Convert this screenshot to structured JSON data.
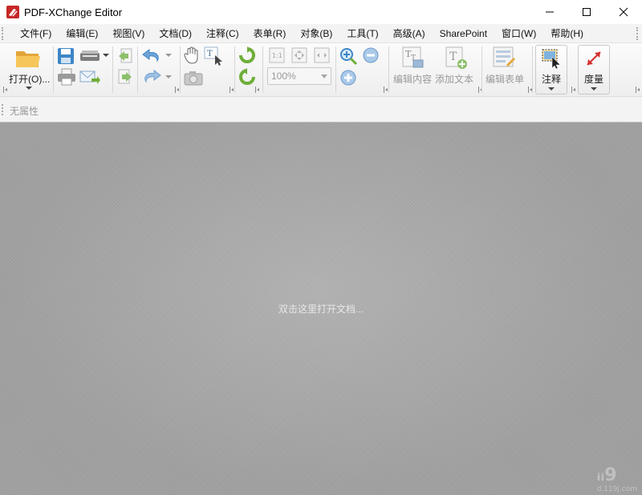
{
  "window": {
    "title": "PDF-XChange Editor",
    "minimize_icon": "minimize-icon",
    "maximize_icon": "maximize-icon",
    "close_icon": "close-icon"
  },
  "menu": {
    "items": [
      "文件(F)",
      "编辑(E)",
      "视图(V)",
      "文档(D)",
      "注释(C)",
      "表单(R)",
      "对象(B)",
      "工具(T)",
      "高级(A)",
      "SharePoint",
      "窗口(W)",
      "帮助(H)"
    ]
  },
  "toolbar": {
    "open_label": "打开(O)...",
    "zoom_value": "100%",
    "edit_content_label": "编辑内容",
    "add_text_label": "添加文本",
    "edit_form_label": "编辑表单",
    "comment_label": "注释",
    "measure_label": "度量",
    "colors": {
      "folder": "#f2b84b",
      "accent_green": "#6fae3a",
      "accent_blue": "#3d86c8",
      "measure_red": "#d32f2f"
    }
  },
  "properties": {
    "text": "无属性"
  },
  "document": {
    "hint": "双击这里打开文档...",
    "watermark": "ᵢᵢ9",
    "watermark_sub": "d.119j.com"
  }
}
